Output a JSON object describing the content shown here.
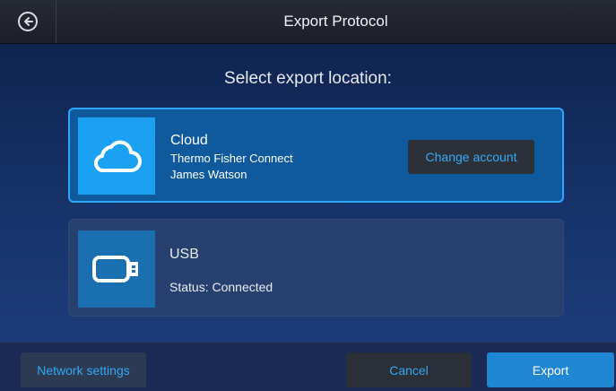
{
  "header": {
    "title": "Export Protocol",
    "back_icon": "arrow-left-circle-icon"
  },
  "main": {
    "prompt": "Select export location:",
    "options": [
      {
        "id": "cloud",
        "icon": "cloud-icon",
        "title": "Cloud",
        "lines": [
          "Thermo Fisher Connect",
          "James Watson"
        ],
        "button": "Change account",
        "selected": true
      },
      {
        "id": "usb",
        "icon": "usb-drive-icon",
        "title": "USB",
        "lines": [
          "Status: Connected"
        ],
        "selected": false
      }
    ]
  },
  "footer": {
    "network": "Network settings",
    "cancel": "Cancel",
    "export": "Export"
  },
  "colors": {
    "accent": "#2ea6ff",
    "primary_button": "#1f86d4",
    "link_text": "#34a7f3"
  }
}
